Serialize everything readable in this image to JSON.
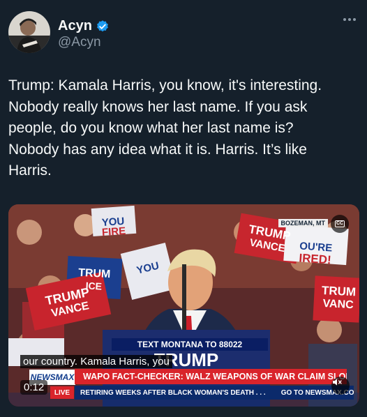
{
  "author": {
    "name": "Acyn",
    "handle": "@Acyn",
    "verified": true,
    "verified_color": "#1d9bf0"
  },
  "icons": {
    "more": "more-horizontal-icon",
    "verified": "verified-badge-icon",
    "captions": "closed-captions-icon",
    "mute": "volume-muted-icon"
  },
  "tweet": {
    "text": "Trump: Kamala Harris, you know, it's interesting.\nNobody really knows her last name. If you ask\npeople, do you know what her last name is?\nNobody has any idea what it is. Harris. It’s like\nHarris."
  },
  "video": {
    "duration": "0:12",
    "caption": "our country. Kamala Harris, you",
    "cc_label": "CC",
    "location_tag": "BOZEMAN, MT",
    "podium_banner": "TEXT MONTANA TO 88022",
    "network": "NEWSMAX",
    "live_label": "LIVE",
    "headline": "WAPO FACT-CHECKER: WALZ WEAPONS OF WAR CLAIM SLOPPY & FALSE",
    "ticker_left": "RETIRING WEEKS AFTER BLACK WOMAN'S DEATH . . .",
    "ticker_right": "GO TO NEWSMAX.COM FOR B"
  },
  "colors": {
    "background": "#15202b",
    "text_primary": "#f7f9f9",
    "text_secondary": "#8b98a5",
    "newsmax_red": "#d9242b",
    "newsmax_blue": "#0b2a6b"
  }
}
